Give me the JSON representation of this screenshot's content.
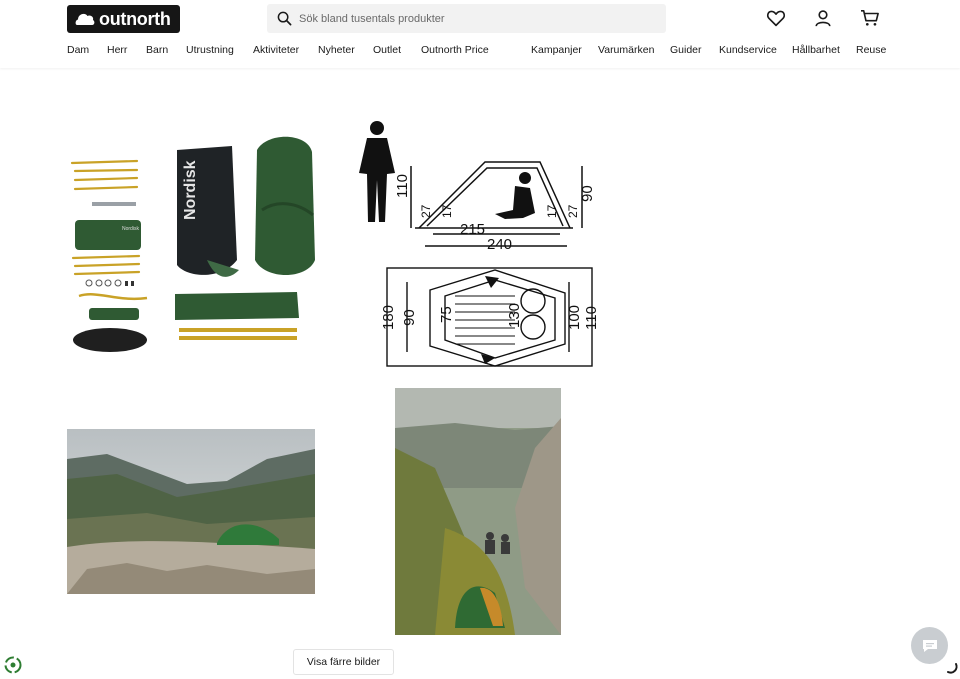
{
  "header": {
    "logo_text": "outnorth",
    "search": {
      "placeholder": "Sök bland tusentals produkter",
      "value": ""
    },
    "icons": [
      "heart-icon",
      "user-icon",
      "cart-icon"
    ]
  },
  "nav": {
    "left": [
      "Dam",
      "Herr",
      "Barn",
      "Utrustning",
      "Aktiviteter",
      "Nyheter",
      "Outlet",
      "Outnorth Price"
    ],
    "right": [
      "Kampanjer",
      "Varumärken",
      "Guider",
      "Kundservice",
      "Hållbarhet",
      "Reuse"
    ]
  },
  "gallery": {
    "diagram": {
      "side_view": {
        "height_person": "110",
        "inner_small": [
          "27",
          "17",
          "17",
          "27"
        ],
        "height_right": "90",
        "inner_length": "215",
        "outer_length": "240"
      },
      "top_view": {
        "left_outer": "180",
        "left_inner": "90",
        "vestibule": "75",
        "center": "130",
        "right_inner": "100",
        "right_outer": "110"
      }
    },
    "product_text": "Nordisk"
  },
  "button": {
    "show_fewer": "Visa färre bilder"
  },
  "colors": {
    "tent_green": "#2f5a33",
    "pole_gold": "#c9a227",
    "dark": "#161616",
    "chat_bg": "#c9cdd1"
  }
}
